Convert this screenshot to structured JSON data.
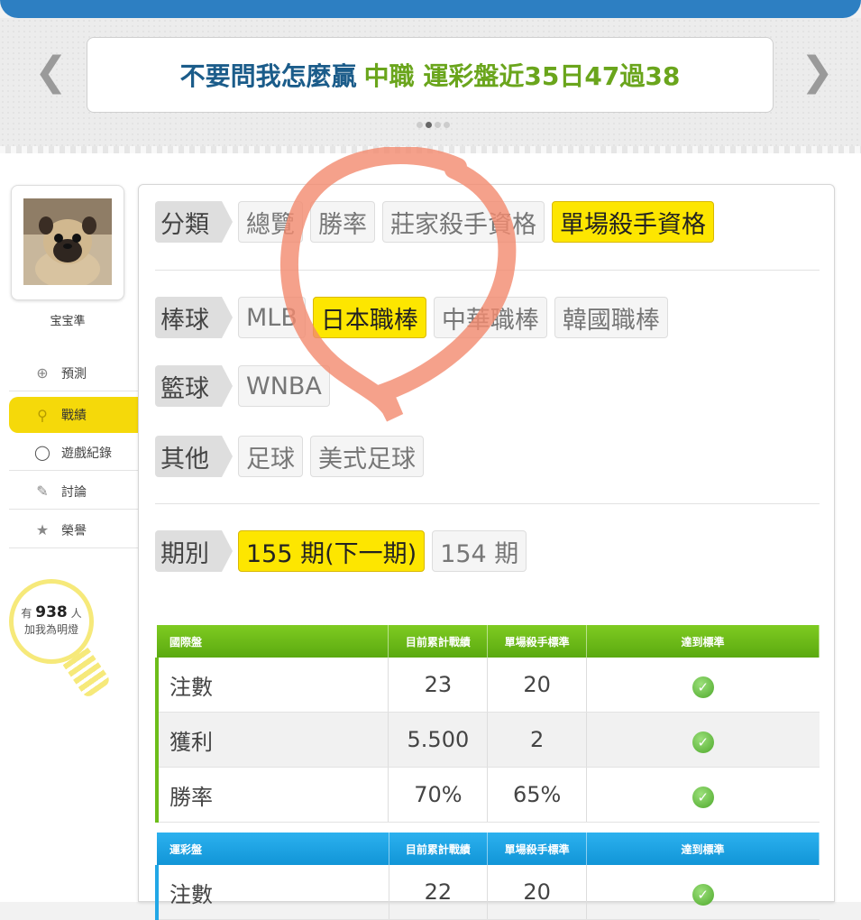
{
  "banner": {
    "title_part1": "不要問我怎麼贏",
    "title_part2": "中職 運彩盤近35日47過38",
    "prev_icon": "chevron-left-icon",
    "next_icon": "chevron-right-icon"
  },
  "user": {
    "name": "宝宝準",
    "fans_prefix": "有",
    "fans_count": "938",
    "fans_suffix": "人",
    "fans_text": "加我為明燈"
  },
  "sidebar": {
    "items": [
      {
        "label": "預測",
        "icon": "target-icon"
      },
      {
        "label": "戰績",
        "icon": "chart-icon"
      },
      {
        "label": "遊戲紀錄",
        "icon": "circle-icon"
      },
      {
        "label": "討論",
        "icon": "chat-icon"
      },
      {
        "label": "榮譽",
        "icon": "medal-icon"
      }
    ]
  },
  "filters": {
    "category": {
      "label": "分類",
      "options": [
        "總覽",
        "勝率",
        "莊家殺手資格",
        "單場殺手資格"
      ],
      "selected": "單場殺手資格"
    },
    "baseball": {
      "label": "棒球",
      "options": [
        "MLB",
        "日本職棒",
        "中華職棒",
        "韓國職棒"
      ],
      "selected": "日本職棒"
    },
    "basketball": {
      "label": "籃球",
      "options": [
        "WNBA"
      ]
    },
    "other": {
      "label": "其他",
      "options": [
        "足球",
        "美式足球"
      ]
    },
    "period": {
      "label": "期別",
      "options": [
        "155 期(下一期)",
        "154 期"
      ],
      "selected": "155 期(下一期)"
    }
  },
  "tables": {
    "international": {
      "headers": [
        "國際盤",
        "目前累計戰績",
        "單場殺手標準",
        "達到標準"
      ],
      "rows": [
        {
          "label": "注數",
          "current": "23",
          "standard": "20"
        },
        {
          "label": "獲利",
          "current": "5.500",
          "standard": "2"
        },
        {
          "label": "勝率",
          "current": "70%",
          "standard": "65%"
        }
      ]
    },
    "sports_lottery": {
      "headers": [
        "運彩盤",
        "目前累計戰績",
        "單場殺手標準",
        "達到標準"
      ],
      "rows": [
        {
          "label": "注數",
          "current": "22",
          "standard": "20"
        }
      ]
    }
  },
  "colors": {
    "accent_yellow": "#fde600",
    "green_header": "#6dbd1a",
    "blue_header": "#1ea3e3",
    "title_blue": "#1b5c8a",
    "title_green": "#6aa51c"
  }
}
